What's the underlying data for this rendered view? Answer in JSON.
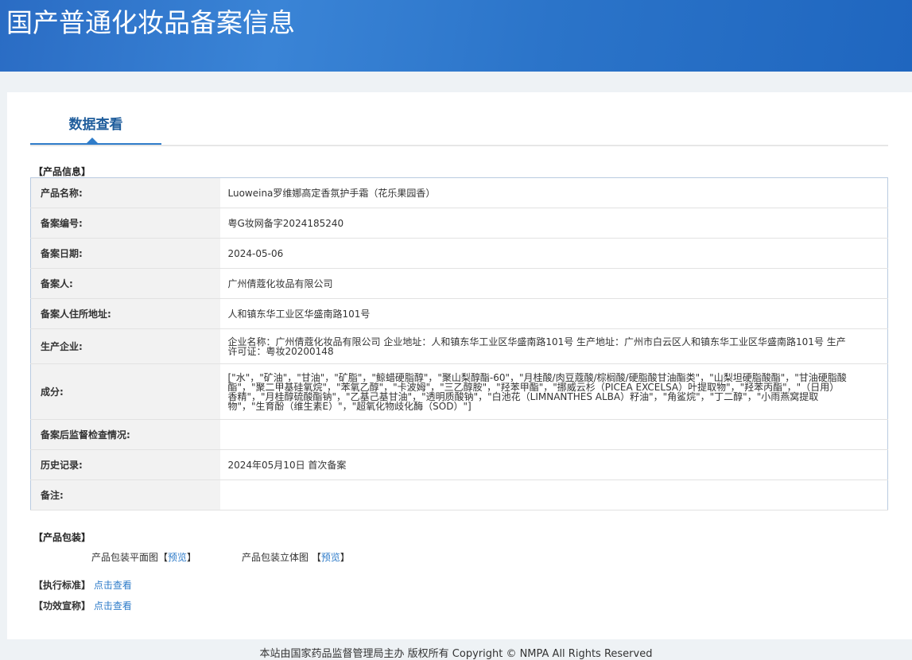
{
  "header": {
    "title": "国产普通化妆品备案信息"
  },
  "tab": {
    "label": "数据查看"
  },
  "product_info": {
    "section_label": "【产品信息】",
    "rows": [
      {
        "label": "产品名称:",
        "value": "Luoweina罗维娜高定香氛护手霜（花乐果园香）"
      },
      {
        "label": "备案编号:",
        "value": "粤G妆网备字2024185240"
      },
      {
        "label": "备案日期:",
        "value": "2024-05-06"
      },
      {
        "label": "备案人:",
        "value": "广州倩蔻化妆品有限公司"
      },
      {
        "label": "备案人住所地址:",
        "value": "人和镇东华工业区华盛南路101号"
      },
      {
        "label": "生产企业:",
        "value": "企业名称：广州倩蔻化妆品有限公司 企业地址：人和镇东华工业区华盛南路101号 生产地址：广州市白云区人和镇东华工业区华盛南路101号 生产许可证：粤妆20200148"
      },
      {
        "label": "成分:",
        "value": "[\"水\"，\"矿油\"，\"甘油\"，\"矿脂\"，\"鲸蜡硬脂醇\"，\"聚山梨醇酯-60\"，\"月桂酸/肉豆蔻酸/棕榈酸/硬脂酸甘油酯类\"，\"山梨坦硬脂酸酯\"，\"甘油硬脂酸酯\"，\"聚二甲基硅氧烷\"，\"苯氧乙醇\"，\"卡波姆\"，\"三乙醇胺\"，\"羟苯甲酯\"，\"挪威云杉（PICEA EXCELSA）叶提取物\"，\"羟苯丙酯\"，\"（日用）香精\"，\"月桂醇硫酸酯钠\"，\"乙基己基甘油\"，\"透明质酸钠\"，\"白池花（LIMNANTHES ALBA）籽油\"，\"角鲨烷\"，\"丁二醇\"，\"小雨燕窝提取物\"，\"生育酚（维生素E）\"，\"超氧化物歧化酶（SOD）\"]"
      },
      {
        "label": "备案后监督检查情况:",
        "value": ""
      },
      {
        "label": "历史记录:",
        "value": "2024年05月10日 首次备案"
      },
      {
        "label": "备注:",
        "value": ""
      }
    ]
  },
  "packaging": {
    "section_label": "【产品包装】",
    "flat_label": "产品包装平面图【",
    "flat_link": "预览",
    "flat_end": "】",
    "solid_label": "产品包装立体图 【",
    "solid_link": "预览",
    "solid_end": "】"
  },
  "standard": {
    "label": "【执行标准】",
    "link": "点击查看"
  },
  "claims": {
    "label": "【功效宣称】",
    "link": "点击查看"
  },
  "footer": {
    "text": "本站由国家药品监督管理局主办 版权所有 Copyright © NMPA All Rights Reserved"
  }
}
